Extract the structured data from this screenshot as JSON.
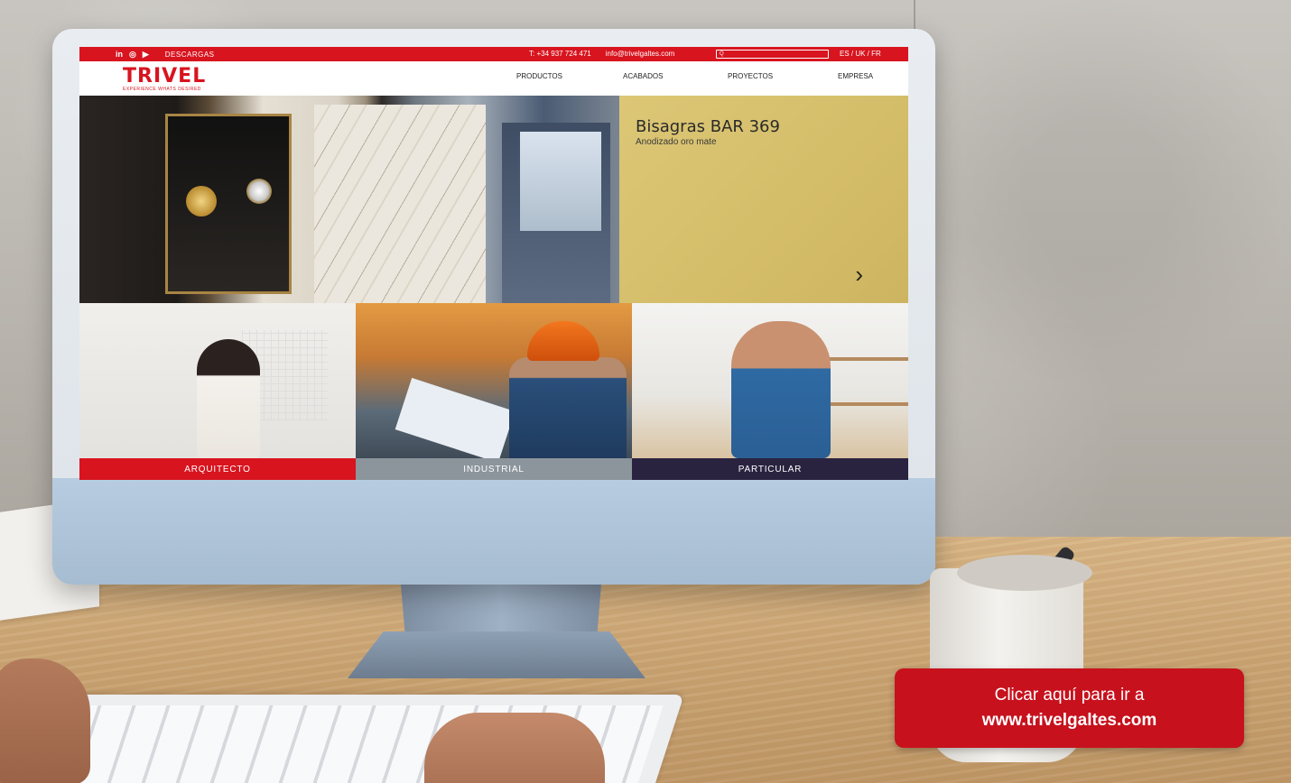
{
  "website": {
    "topbar": {
      "social": [
        "in",
        "◎",
        "▶"
      ],
      "downloads_label": "DESCARGAS",
      "phone": "T: +34 937 724 471",
      "email": "info@trivelgaltes.com",
      "search_placeholder": "Q",
      "languages": "ES / UK / FR"
    },
    "logo": {
      "name": "TRIVEL",
      "tagline": "EXPERIENCE WHATS DESIRED"
    },
    "nav": [
      "PRODUCTOS",
      "ACABADOS",
      "PROYECTOS",
      "EMPRESA"
    ],
    "hero": {
      "title": "Bisagras BAR 369",
      "subtitle": "Anodizado oro mate",
      "next_arrow": "›"
    },
    "categories": [
      {
        "label": "ARQUITECTO",
        "color": "#d8141f"
      },
      {
        "label": "INDUSTRIAL",
        "color": "#8c959c"
      },
      {
        "label": "PARTICULAR",
        "color": "#2a2340"
      }
    ]
  },
  "cta": {
    "line1": "Clicar aquí para ir a",
    "line2": "www.trivelgaltes.com",
    "color": "#c7111d"
  }
}
